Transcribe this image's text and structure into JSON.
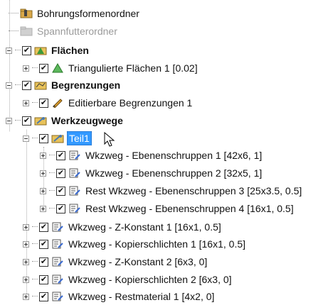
{
  "tree": {
    "items": [
      {
        "label": "Bohrungsformenordner"
      },
      {
        "label": "Spannfutterordner"
      },
      {
        "label": "Flächen"
      },
      {
        "label": "Triangulierte Flächen 1 [0.02]"
      },
      {
        "label": "Begrenzungen"
      },
      {
        "label": "Editierbare Begrenzungen 1"
      },
      {
        "label": "Werkzeugwege"
      },
      {
        "label": "Teil1"
      },
      {
        "label": "Wkzweg - Ebenenschruppen 1 [42x6, 1]"
      },
      {
        "label": "Wkzweg - Ebenenschruppen 2 [32x5, 1]"
      },
      {
        "label": "Rest Wkzweg - Ebenenschruppen 3 [25x3.5, 0.5]"
      },
      {
        "label": "Rest Wkzweg - Ebenenschruppen 4 [16x1, 0.5]"
      },
      {
        "label": "Wkzweg - Z-Konstant 1 [16x1, 0.5]"
      },
      {
        "label": "Wkzweg - Kopierschlichten 1 [16x1, 0.5]"
      },
      {
        "label": "Wkzweg - Z-Konstant 2 [6x3, 0]"
      },
      {
        "label": "Wkzweg - Kopierschlichten 2 [6x3, 0]"
      },
      {
        "label": "Wkzweg - Restmaterial 1 [4x2, 0]"
      }
    ],
    "checkmark": "✔"
  },
  "colors": {
    "selection": "#3399ff",
    "folder_yellow": "#e8c25a",
    "surface_green": "#3a9a3a",
    "disabled_gray": "#9a9a9a"
  }
}
